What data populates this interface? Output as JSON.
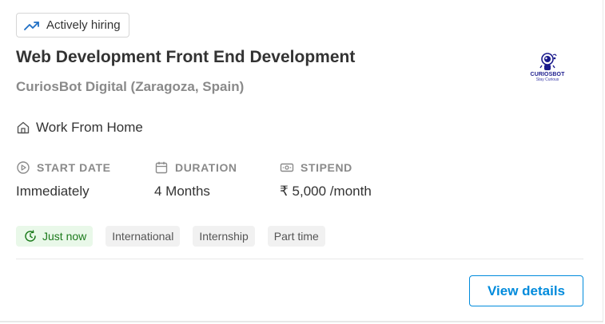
{
  "badge": {
    "label": "Actively hiring",
    "icon": "trending-up-icon"
  },
  "job": {
    "title": "Web Development Front End Development",
    "company": "CuriosBot Digital (Zaragoza, Spain)",
    "location": "Work From Home"
  },
  "logo": {
    "name": "CURIOSBOT",
    "tagline": "Stay Curious"
  },
  "meta": {
    "start_date": {
      "label": "START DATE",
      "value": "Immediately",
      "icon": "play-circle-icon"
    },
    "duration": {
      "label": "DURATION",
      "value": "4 Months",
      "icon": "calendar-icon"
    },
    "stipend": {
      "label": "STIPEND",
      "value": "₹ 5,000 /month",
      "icon": "money-icon"
    }
  },
  "tags": {
    "posted": "Just now",
    "items": [
      "International",
      "Internship",
      "Part time"
    ]
  },
  "actions": {
    "view_details": "View details"
  },
  "colors": {
    "accent": "#008bdc",
    "posted_bg": "#e9f8e9",
    "posted_text": "#1b7a1b"
  }
}
